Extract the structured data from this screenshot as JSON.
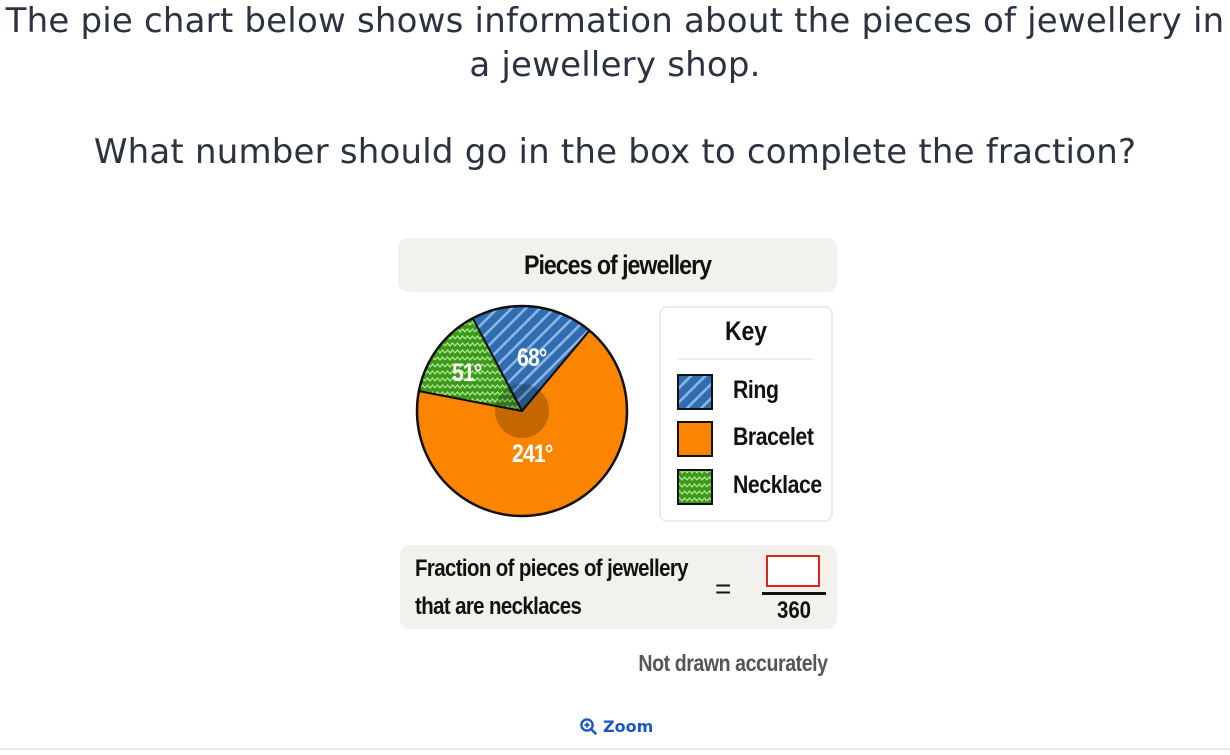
{
  "question": {
    "line1": "The pie chart below shows information about the pieces of jewellery in",
    "line2": "a jewellery shop.",
    "line3": "What number should go in the box to complete the fraction?"
  },
  "chart_data": {
    "type": "pie",
    "title": "Pieces of jewellery",
    "slices": [
      {
        "label": "Ring",
        "value": 68,
        "value_label": "68°",
        "color": "#2f6db0",
        "pattern": "diagonal-stripes"
      },
      {
        "label": "Bracelet",
        "value": 241,
        "value_label": "241°",
        "color": "#fb8500",
        "pattern": "solid"
      },
      {
        "label": "Necklace",
        "value": 51,
        "value_label": "51°",
        "color": "#3a9a1c",
        "pattern": "zigzag"
      }
    ]
  },
  "key": {
    "title": "Key",
    "items": [
      "Ring",
      "Bracelet",
      "Necklace"
    ]
  },
  "fraction": {
    "line1": "Fraction of pieces of jewellery",
    "line2": "that are necklaces",
    "equals": "=",
    "numerator": "",
    "denominator": "360"
  },
  "note": "Not drawn accurately",
  "zoom": {
    "label": "Zoom",
    "icon": "zoom-in-icon"
  },
  "colors": {
    "answer_box_border": "#e2231a",
    "link": "#1a56c9"
  }
}
